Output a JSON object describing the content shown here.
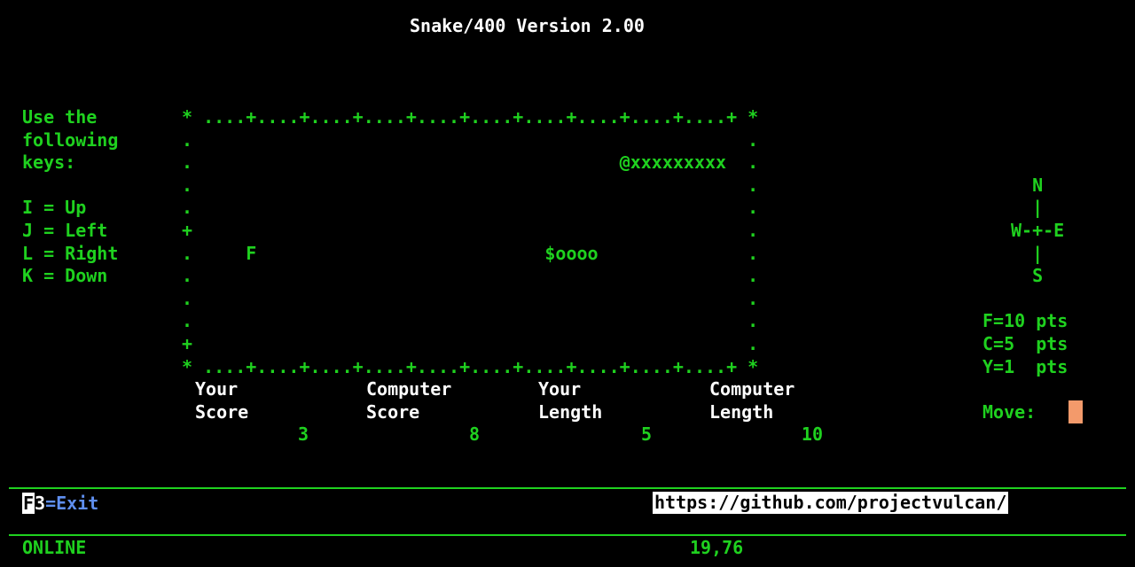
{
  "title": "Snake/400 Version 2.00",
  "instructions": {
    "lines": [
      "Use the",
      "following",
      "keys:",
      "",
      "I = Up",
      "J = Left",
      "L = Right",
      "K = Down"
    ]
  },
  "board": {
    "rows": [
      "* ....+....+....+....+....+....+....+....+....+....+ *",
      ".                                                    .",
      ".                                        @xxxxxxxxx  .",
      ".                                                    .",
      ".                                                    .",
      "+                                                    .",
      ".     F                           $oooo              .",
      ".                                                    .",
      ".                                                    .",
      ".                                                    .",
      "+                                                    .",
      "* ....+....+....+....+....+....+....+....+....+....+ *"
    ]
  },
  "compass": {
    "lines": [
      "  N  ",
      "  |  ",
      "W-+-E",
      "  |  ",
      "  S  "
    ]
  },
  "points": {
    "lines": [
      "F=10 pts",
      "C=5  pts",
      "Y=1  pts"
    ]
  },
  "stats": {
    "your_score_label_1": "Your",
    "your_score_label_2": "Score",
    "your_score_value": "3",
    "computer_score_label_1": "Computer",
    "computer_score_label_2": "Score",
    "computer_score_value": "8",
    "your_length_label_1": "Your",
    "your_length_label_2": "Length",
    "your_length_value": "5",
    "computer_length_label_1": "Computer",
    "computer_length_label_2": "Length",
    "computer_length_value": "10"
  },
  "move": {
    "label": "Move:",
    "value": ""
  },
  "footer": {
    "fkey_key": "F",
    "fkey_num": "3",
    "fkey_label": "=Exit",
    "url": "https://github.com/projectvulcan/"
  },
  "status": {
    "state": "ONLINE",
    "cursor_position": "19,76"
  },
  "colors": {
    "background": "#000000",
    "text_green": "#1fd11f",
    "text_white": "#ffffff",
    "text_blue": "#5f8ff0",
    "cursor": "#f39a6b"
  }
}
